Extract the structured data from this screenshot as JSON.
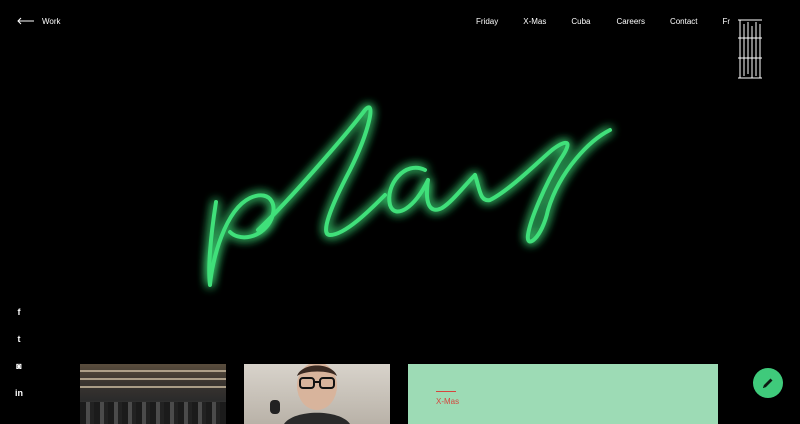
{
  "header": {
    "back_label": "Work",
    "nav": [
      "Friday",
      "X-Mas",
      "Cuba",
      "Careers",
      "Contact",
      "Fr"
    ]
  },
  "hero": {
    "neon_text": "play",
    "neon_color": "#3fe07a"
  },
  "social": [
    {
      "icon": "facebook-icon",
      "glyph": "f"
    },
    {
      "icon": "twitter-icon",
      "glyph": "t"
    },
    {
      "icon": "instagram-icon",
      "glyph": "◙"
    },
    {
      "icon": "linkedin-icon",
      "glyph": "in"
    }
  ],
  "cards": {
    "third_tag": "X-Mas",
    "third_bg": "#9ddbb5",
    "accent": "#d6453d"
  },
  "fab": {
    "icon": "edit-icon",
    "color": "#3fca7b"
  }
}
